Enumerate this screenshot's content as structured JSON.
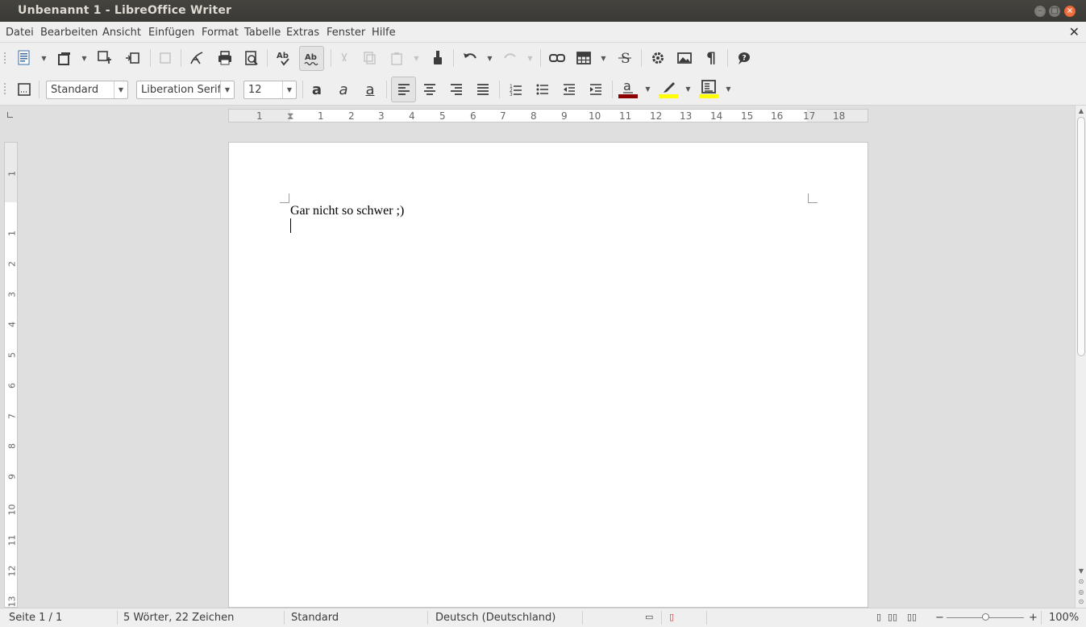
{
  "window": {
    "title": "Unbenannt 1 - LibreOffice Writer",
    "minimize_glyph": "–",
    "maximize_glyph": "□",
    "close_glyph": "×"
  },
  "menubar": {
    "items": [
      "Datei",
      "Bearbeiten",
      "Ansicht",
      "Einfügen",
      "Format",
      "Tabelle",
      "Extras",
      "Fenster",
      "Hilfe"
    ],
    "close_doc": "✕"
  },
  "formatting": {
    "paragraph_style": "Standard",
    "font_name": "Liberation Serif",
    "font_size": "12"
  },
  "ruler": {
    "horizontal_numbers": [
      "1",
      "1",
      "2",
      "3",
      "4",
      "5",
      "6",
      "7",
      "8",
      "9",
      "10",
      "11",
      "12",
      "13",
      "14",
      "15",
      "16",
      "17",
      "18"
    ],
    "vertical_numbers": [
      "1",
      "1",
      "2",
      "3",
      "4",
      "5",
      "6",
      "7",
      "8",
      "9",
      "10",
      "11",
      "12",
      "13"
    ]
  },
  "document": {
    "text": "Gar nicht so schwer ;)"
  },
  "status": {
    "page": "Seite 1 / 1",
    "words": "5 Wörter, 22 Zeichen",
    "page_style": "Standard",
    "language": "Deutsch (Deutschland)",
    "zoom": "100%"
  },
  "colors": {
    "font_color": "#8b0000",
    "highlight_color": "#ffff00",
    "background_color": "#ffff00",
    "title_bar": "#3c3b37",
    "close_button": "#e95420"
  }
}
